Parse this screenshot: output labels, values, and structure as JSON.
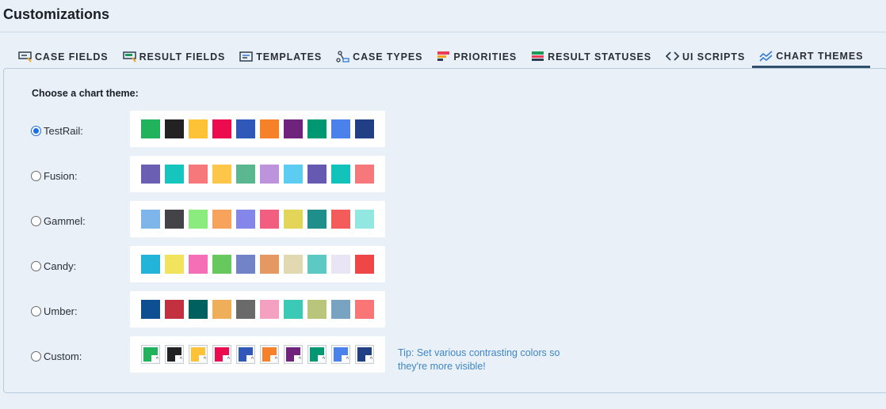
{
  "page": {
    "title": "Customizations"
  },
  "tabs": [
    {
      "label": "CASE FIELDS",
      "icon": "case-fields-icon",
      "active": false
    },
    {
      "label": "RESULT FIELDS",
      "icon": "result-fields-icon",
      "active": false
    },
    {
      "label": "TEMPLATES",
      "icon": "templates-icon",
      "active": false
    },
    {
      "label": "CASE TYPES",
      "icon": "case-types-icon",
      "active": false
    },
    {
      "label": "PRIORITIES",
      "icon": "priorities-icon",
      "active": false
    },
    {
      "label": "RESULT STATUSES",
      "icon": "result-statuses-icon",
      "active": false
    },
    {
      "label": "UI SCRIPTS",
      "icon": "ui-scripts-icon",
      "active": false
    },
    {
      "label": "CHART THEMES",
      "icon": "chart-themes-icon",
      "active": true
    }
  ],
  "panel": {
    "choose_label": "Choose a chart theme:",
    "tip": "Tip: Set various contrasting colors so they're more visible!"
  },
  "themes": [
    {
      "name": "TestRail:",
      "checked": true,
      "colors": [
        "#21b35b",
        "#222222",
        "#fec236",
        "#ec0b4e",
        "#2f58b8",
        "#f68129",
        "#6f237d",
        "#009873",
        "#4a81eb",
        "#213f84"
      ]
    },
    {
      "name": "Fusion:",
      "checked": false,
      "colors": [
        "#6a5fb3",
        "#16c5bd",
        "#f7787a",
        "#fec649",
        "#5bb78f",
        "#bd93de",
        "#5ccdf1",
        "#6559b2",
        "#12c3b9",
        "#f7787a"
      ]
    },
    {
      "name": "Gammel:",
      "checked": false,
      "colors": [
        "#7eb5ea",
        "#434348",
        "#8ceb7f",
        "#f7a35c",
        "#8586e9",
        "#f25e7f",
        "#e3d557",
        "#208e8a",
        "#f45b5b",
        "#92e8e1"
      ]
    },
    {
      "name": "Candy:",
      "checked": false,
      "colors": [
        "#25b4d9",
        "#f1e35d",
        "#f56fb6",
        "#67c85e",
        "#7283c7",
        "#e69863",
        "#e2d8b1",
        "#5dc9c5",
        "#eae5f5",
        "#ef4748"
      ]
    },
    {
      "name": "Umber:",
      "checked": false,
      "colors": [
        "#0d4f90",
        "#c33040",
        "#005f5f",
        "#eeae5a",
        "#6a6a6a",
        "#f4a0c1",
        "#3cc9b5",
        "#b9c57b",
        "#78a4c1",
        "#f97576"
      ]
    },
    {
      "name": "Custom:",
      "checked": false,
      "custom": true,
      "colors": [
        "#21b35b",
        "#222222",
        "#fec236",
        "#ec0b4e",
        "#2f58b8",
        "#f68129",
        "#6f237d",
        "#009873",
        "#4a81eb",
        "#213f84"
      ]
    }
  ]
}
